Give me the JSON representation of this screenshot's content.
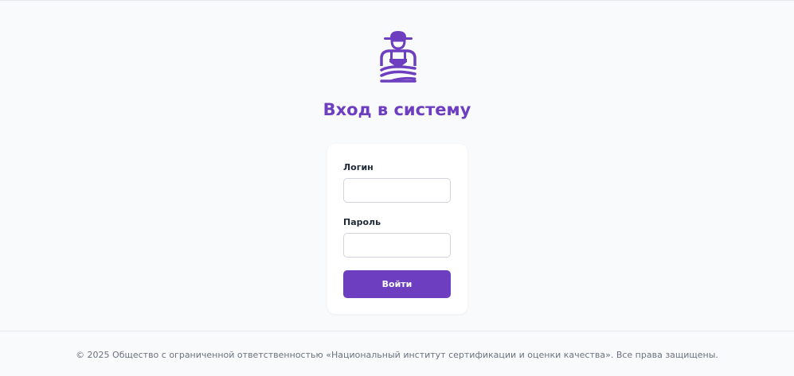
{
  "brand": {
    "logo_icon": "farmer-icon",
    "accent_color": "#6d3fc0"
  },
  "page": {
    "title": "Вход в систему"
  },
  "login_form": {
    "login_label": "Логин",
    "login_value": "",
    "password_label": "Пароль",
    "password_value": "",
    "submit_label": "Войти"
  },
  "footer": {
    "copyright": "© 2025 Общество с ограниченной ответственностью «Национальный институт сертификации и оценки качества». Все права защищены."
  }
}
